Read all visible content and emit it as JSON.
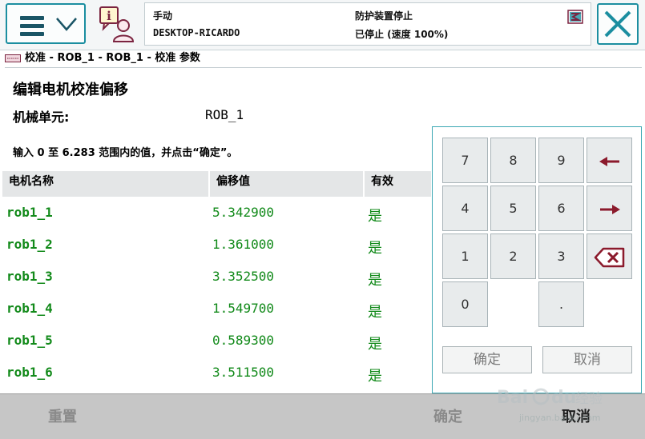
{
  "header": {
    "mode": "手动",
    "hostname": "DESKTOP-RICARDO",
    "guard_status": "防护装置停止",
    "run_status": "已停止 (速度 100%)"
  },
  "breadcrumb": "校准 - ROB_1 - ROB_1 - 校准 参数",
  "page": {
    "title": "编辑电机校准偏移",
    "unit_label": "机械单元:",
    "unit_value": "ROB_1",
    "instruction": "输入 0 至 6.283 范围内的值，并点击“确定”。"
  },
  "table": {
    "columns": [
      "电机名称",
      "偏移值",
      "有效"
    ],
    "rows": [
      {
        "name": "rob1_1",
        "offset": "5.342900",
        "valid": "是"
      },
      {
        "name": "rob1_2",
        "offset": "1.361000",
        "valid": "是"
      },
      {
        "name": "rob1_3",
        "offset": "3.352500",
        "valid": "是"
      },
      {
        "name": "rob1_4",
        "offset": "1.549700",
        "valid": "是"
      },
      {
        "name": "rob1_5",
        "offset": "0.589300",
        "valid": "是"
      },
      {
        "name": "rob1_6",
        "offset": "3.511500",
        "valid": "是"
      }
    ]
  },
  "keypad": {
    "keys": {
      "k7": "7",
      "k8": "8",
      "k9": "9",
      "k4": "4",
      "k5": "5",
      "k6": "6",
      "k1": "1",
      "k2": "2",
      "k3": "3",
      "k0": "0",
      "kdot": "."
    },
    "ok_label": "确定",
    "cancel_label": "取消"
  },
  "bottom": {
    "reset_label": "重置",
    "ok_label": "确定",
    "cancel_label": "取消"
  },
  "watermark": {
    "logo": "Bai du 经验",
    "url": "jingyan.baidu.com"
  },
  "colors": {
    "accent": "#1b8ea0",
    "value_green": "#128a1a",
    "arrow_red": "#8b1a2c",
    "bottom_bar": "#c6c6c6"
  },
  "icons": [
    "menu-icon",
    "chevron-down-icon",
    "user-info-icon",
    "event-log-icon",
    "close-icon",
    "keyboard-icon",
    "arrow-left-icon",
    "arrow-right-icon",
    "backspace-icon"
  ]
}
